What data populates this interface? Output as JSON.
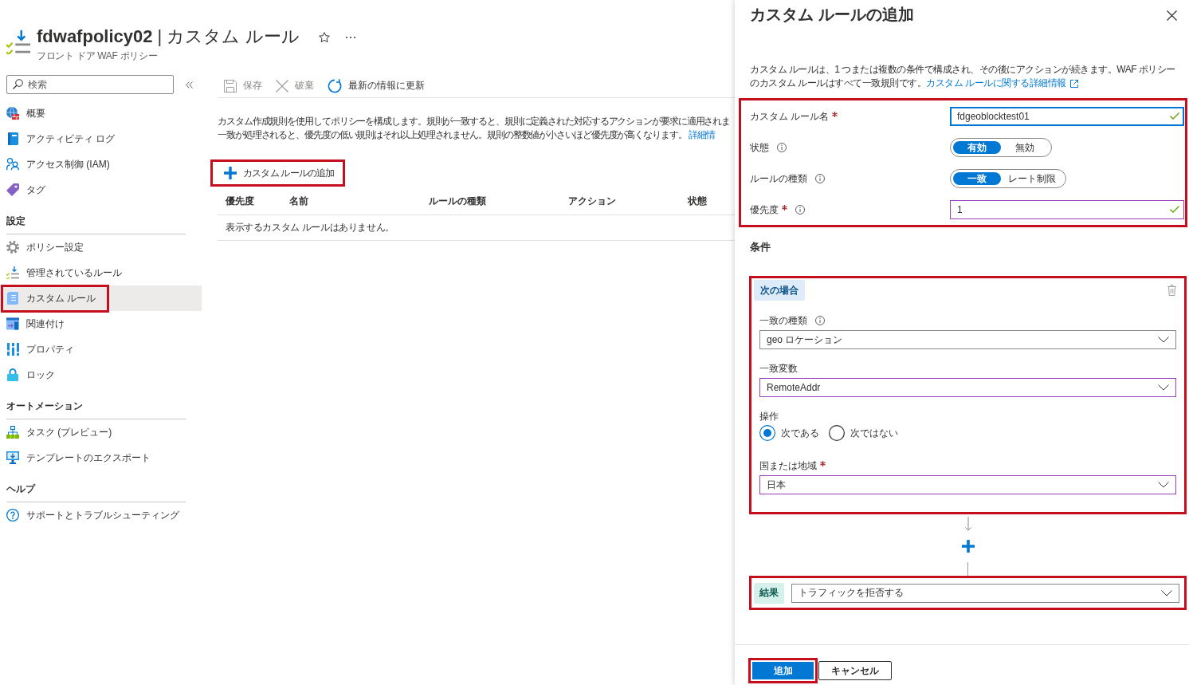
{
  "header": {
    "title": "**fdwafpolicy02** | カスタム ルール",
    "subtitle": "フロント ドア WAF ポリシー",
    "favorite": false
  },
  "sidebar": {
    "search": {
      "placeholder": "検索"
    },
    "groups": [
      {
        "items": [
          {
            "label": "概要",
            "selected": false,
            "highlighted": false
          },
          {
            "label": "アクティビティ ログ",
            "selected": false,
            "highlighted": false
          },
          {
            "label": "アクセス制御 (IAM)",
            "selected": false,
            "highlighted": false
          },
          {
            "label": "タグ",
            "selected": false,
            "highlighted": false
          }
        ]
      },
      {
        "heading": "設定",
        "items": [
          {
            "label": "ポリシー設定",
            "selected": false,
            "highlighted": false
          },
          {
            "label": "管理されているルール",
            "selected": false,
            "highlighted": false
          },
          {
            "label": "カスタム ルール",
            "selected": true,
            "highlighted": true
          },
          {
            "label": "関連付け",
            "selected": false,
            "highlighted": false
          },
          {
            "label": "プロパティ",
            "selected": false,
            "highlighted": false
          },
          {
            "label": "ロック",
            "selected": false,
            "highlighted": false
          }
        ]
      },
      {
        "heading": "オートメーション",
        "items": [
          {
            "label": "タスク (プレビュー)",
            "selected": false,
            "highlighted": false
          },
          {
            "label": "テンプレートのエクスポート",
            "selected": false,
            "highlighted": false
          }
        ]
      },
      {
        "heading": "ヘルプ",
        "items": [
          {
            "label": "サポートとトラブルシューティング",
            "selected": false,
            "highlighted": false
          }
        ]
      }
    ]
  },
  "toolbar": [
    {
      "label": "保存",
      "disabled": true
    },
    {
      "label": "破棄",
      "disabled": true
    },
    {
      "label": "最新の情報に更新",
      "disabled": false
    }
  ],
  "content": {
    "description": {
      "lines": [
        "カスタム作成規則を使用してポリシーを構成します。規則が一致すると、規則に定義された対応するアクションが要求に適用されま",
        "一致が処理されると、優先度の低い規則はそれ以上処理されません。規則の整数値が小さいほど優先度が高くなります。"
      ],
      "link": "詳細情"
    },
    "add_button": {
      "label": "カスタム ルールの追加",
      "highlighted": true
    },
    "table": {
      "columns": [
        "優先度",
        "名前",
        "ルールの種類",
        "アクション",
        "状態"
      ],
      "empty_message": "表示するカスタム ルールはありません。"
    }
  },
  "panel": {
    "title": "カスタム ルールの追加",
    "description": "カスタム ルールは、1 つまたは複数の条件で構成され、その後にアクションが続きます。WAF ポリシーのカスタム ルールはすべて一致規則です。",
    "link": "カスタム ルールに関する詳細情報",
    "settings": {
      "highlighted": true,
      "fields": [
        {
          "kind": "text",
          "label": "カスタム ルール名",
          "required": true,
          "info": false,
          "value": "fdgeoblocktest01",
          "focused": true,
          "modified": true,
          "valid": true
        },
        {
          "kind": "toggle",
          "label": "状態",
          "required": false,
          "info": true,
          "options": [
            {
              "label": "有効",
              "selected": true
            },
            {
              "label": "無効",
              "selected": false
            }
          ]
        },
        {
          "kind": "toggle",
          "label": "ルールの種類",
          "required": false,
          "info": true,
          "options": [
            {
              "label": "一致",
              "selected": true
            },
            {
              "label": "レート制限",
              "selected": false
            }
          ]
        },
        {
          "kind": "text",
          "label": "優先度",
          "required": true,
          "info": true,
          "value": "1",
          "focused": false,
          "modified": true,
          "valid": true
        }
      ]
    },
    "conditions_heading": "条件",
    "condition": {
      "highlighted": true,
      "badge": "次の場合",
      "fields": [
        {
          "kind": "dropdown",
          "label": "一致の種類",
          "required": false,
          "info": true,
          "value": "geo ロケーション",
          "modified": false
        },
        {
          "kind": "dropdown",
          "label": "一致変数",
          "required": false,
          "info": false,
          "value": "RemoteAddr",
          "modified": true
        },
        {
          "kind": "radio",
          "label": "操作",
          "required": false,
          "info": false,
          "options": [
            {
              "label": "次である",
              "selected": true
            },
            {
              "label": "次ではない",
              "selected": false
            }
          ]
        },
        {
          "kind": "dropdown",
          "label": "国または地域",
          "required": true,
          "info": false,
          "value": "日本",
          "modified": true
        }
      ]
    },
    "result": {
      "highlighted": true,
      "badge": "結果",
      "value": "トラフィックを拒否する",
      "modified": false
    },
    "buttons": [
      {
        "label": "追加",
        "kind": "primary",
        "highlighted": true
      },
      {
        "label": "キャンセル",
        "kind": "secondary",
        "highlighted": false
      }
    ]
  }
}
